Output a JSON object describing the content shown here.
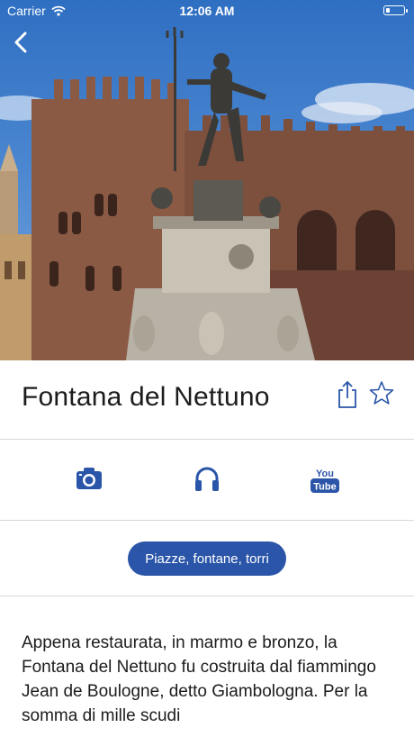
{
  "status_bar": {
    "carrier": "Carrier",
    "time": "12:06 AM"
  },
  "header": {
    "title": "Fontana del Nettuno"
  },
  "media": {
    "youtube_you": "You",
    "youtube_tube": "Tube"
  },
  "category": {
    "label": "Piazze, fontane, torri"
  },
  "description": {
    "text": "Appena restaurata, in marmo e bronzo, la Fontana del Nettuno fu costruita dal fiammingo Jean de Boulogne, detto Giambologna. Per la somma di mille scudi"
  },
  "colors": {
    "accent": "#2a55a8",
    "icon": "#2a55a8",
    "divider": "#d8d8dc",
    "text": "#1c1c1e"
  },
  "icons": [
    "back-chevron-icon",
    "wifi-icon",
    "battery-icon",
    "share-icon",
    "star-icon",
    "camera-icon",
    "headphones-icon",
    "youtube-icon"
  ]
}
